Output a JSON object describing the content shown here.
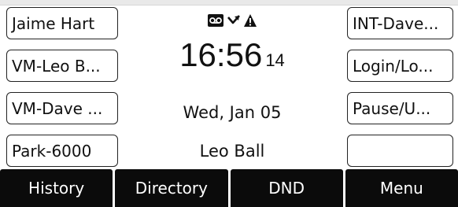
{
  "left_keys": [
    {
      "label": "Jaime Hart"
    },
    {
      "label": "VM-Leo B..."
    },
    {
      "label": "VM-Dave ..."
    },
    {
      "label": "Park-6000"
    }
  ],
  "right_keys": [
    {
      "label": "INT-Dave..."
    },
    {
      "label": "Login/Lo..."
    },
    {
      "label": "Pause/U..."
    },
    {
      "label": ""
    }
  ],
  "status": {
    "icons": [
      "voicemail-icon",
      "missed-call-icon",
      "warning-icon"
    ]
  },
  "clock": {
    "time": "16:56",
    "seconds": "14"
  },
  "date": "Wed, Jan 05",
  "account_name": "Leo Ball",
  "softkeys": [
    {
      "label": "History"
    },
    {
      "label": "Directory"
    },
    {
      "label": "DND"
    },
    {
      "label": "Menu"
    }
  ],
  "colors": {
    "softkey_bg": "#0b0b0b",
    "softkey_text": "#ffffff",
    "key_border": "#222222"
  }
}
